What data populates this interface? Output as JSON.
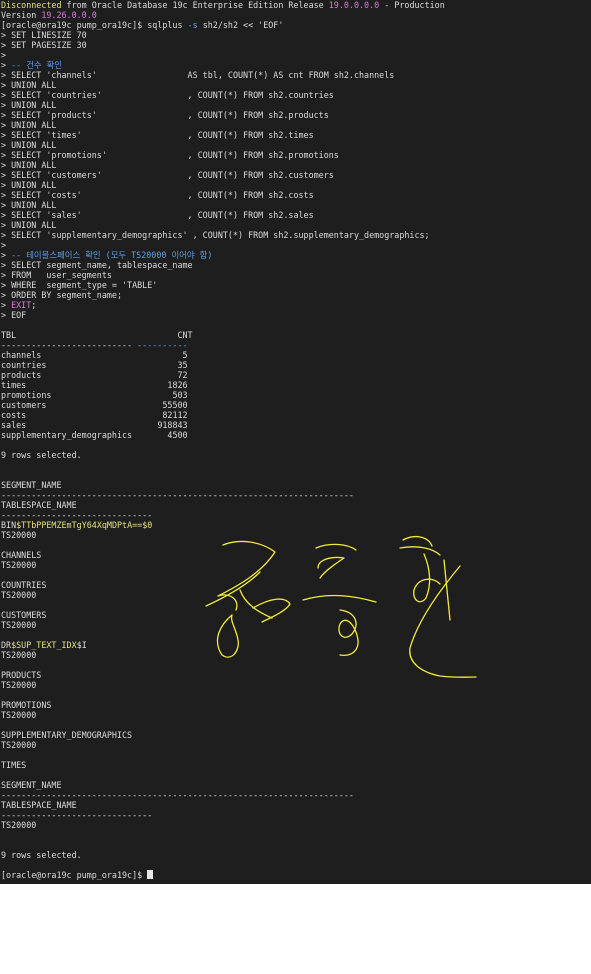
{
  "terminal": {
    "banner": [
      {
        "segs": [
          {
            "t": "Disconnected",
            "c": "c-yel"
          },
          {
            "t": " from Oracle Database 19c Enterprise Edition Release "
          },
          {
            "t": "19.0.0.0.0",
            "c": "c-mag"
          },
          {
            "t": " - Production"
          }
        ]
      },
      {
        "segs": [
          {
            "t": "Version "
          },
          {
            "t": "19.26.0.0.0",
            "c": "c-mag"
          }
        ]
      }
    ],
    "command": [
      {
        "segs": [
          {
            "t": "[oracle@ora19c pump_ora19c]$ sqlplus "
          },
          {
            "t": "-s",
            "c": "c-blue"
          },
          {
            "t": " sh2/sh2 << 'EOF'"
          }
        ]
      },
      {
        "segs": [
          {
            "t": "> SET LINESIZE 70"
          }
        ]
      },
      {
        "segs": [
          {
            "t": "> SET PAGESIZE 30"
          }
        ]
      },
      {
        "segs": [
          {
            "t": ">"
          }
        ]
      },
      {
        "segs": [
          {
            "t": "> "
          },
          {
            "t": "-- 건수 확인",
            "c": "c-blue"
          }
        ]
      },
      {
        "segs": [
          {
            "t": "> SELECT 'channels'                  AS tbl, COUNT(*) AS cnt FROM sh2.channels"
          }
        ]
      },
      {
        "segs": [
          {
            "t": "> UNION ALL"
          }
        ]
      },
      {
        "segs": [
          {
            "t": "> SELECT 'countries'                 , COUNT(*) FROM sh2.countries"
          }
        ]
      },
      {
        "segs": [
          {
            "t": "> UNION ALL"
          }
        ]
      },
      {
        "segs": [
          {
            "t": "> SELECT 'products'                  , COUNT(*) FROM sh2.products"
          }
        ]
      },
      {
        "segs": [
          {
            "t": "> UNION ALL"
          }
        ]
      },
      {
        "segs": [
          {
            "t": "> SELECT 'times'                     , COUNT(*) FROM sh2.times"
          }
        ]
      },
      {
        "segs": [
          {
            "t": "> UNION ALL"
          }
        ]
      },
      {
        "segs": [
          {
            "t": "> SELECT 'promotions'                , COUNT(*) FROM sh2.promotions"
          }
        ]
      },
      {
        "segs": [
          {
            "t": "> UNION ALL"
          }
        ]
      },
      {
        "segs": [
          {
            "t": "> SELECT 'customers'                 , COUNT(*) FROM sh2.customers"
          }
        ]
      },
      {
        "segs": [
          {
            "t": "> UNION ALL"
          }
        ]
      },
      {
        "segs": [
          {
            "t": "> SELECT 'costs'                     , COUNT(*) FROM sh2.costs"
          }
        ]
      },
      {
        "segs": [
          {
            "t": "> UNION ALL"
          }
        ]
      },
      {
        "segs": [
          {
            "t": "> SELECT 'sales'                     , COUNT(*) FROM sh2.sales"
          }
        ]
      },
      {
        "segs": [
          {
            "t": "> UNION ALL"
          }
        ]
      },
      {
        "segs": [
          {
            "t": "> SELECT 'supplementary_demographics' , COUNT(*) FROM sh2.supplementary_demographics;"
          }
        ]
      },
      {
        "segs": [
          {
            "t": ">"
          }
        ]
      },
      {
        "segs": [
          {
            "t": "> "
          },
          {
            "t": "-- 테이블스페이스 확인 (모두 TS20000 이어야 함)",
            "c": "c-blue"
          }
        ]
      },
      {
        "segs": [
          {
            "t": "> SELECT segment_name, tablespace_name"
          }
        ]
      },
      {
        "segs": [
          {
            "t": "> FROM   user_segments"
          }
        ]
      },
      {
        "segs": [
          {
            "t": "> WHERE  segment_type = 'TABLE'"
          }
        ]
      },
      {
        "segs": [
          {
            "t": "> ORDER BY segment_name;"
          }
        ]
      },
      {
        "segs": [
          {
            "t": "> "
          },
          {
            "t": "EXIT",
            "c": "c-mag"
          },
          {
            "t": ";"
          }
        ]
      },
      {
        "segs": [
          {
            "t": "> EOF"
          }
        ]
      },
      {
        "segs": [
          {
            "t": ""
          }
        ]
      }
    ],
    "count_table": {
      "header": "TBL                                CNT",
      "rule": "-------------------------- ----------",
      "rows": [
        {
          "tbl": "channels",
          "cnt": "5"
        },
        {
          "tbl": "countries",
          "cnt": "35"
        },
        {
          "tbl": "products",
          "cnt": "72"
        },
        {
          "tbl": "times",
          "cnt": "1826"
        },
        {
          "tbl": "promotions",
          "cnt": "503"
        },
        {
          "tbl": "customers",
          "cnt": "55500"
        },
        {
          "tbl": "costs",
          "cnt": "82112"
        },
        {
          "tbl": "sales",
          "cnt": "918843"
        },
        {
          "tbl": "supplementary_demographics",
          "cnt": "4500"
        }
      ],
      "rows_selected": "9 rows selected."
    },
    "segment_output": [
      {
        "segs": [
          {
            "t": ""
          }
        ]
      },
      {
        "segs": [
          {
            "t": ""
          }
        ]
      },
      {
        "segs": [
          {
            "t": "SEGMENT_NAME"
          }
        ]
      },
      {
        "segs": [
          {
            "t": "----------------------------------------------------------------------"
          }
        ]
      },
      {
        "segs": [
          {
            "t": "TABLESPACE_NAME"
          }
        ]
      },
      {
        "segs": [
          {
            "t": "------------------------------"
          }
        ]
      },
      {
        "segs": [
          {
            "t": "BIN"
          },
          {
            "t": "$TTbPPEMZEmTgY64XqMDPtA==$0",
            "c": "c-yel"
          }
        ]
      },
      {
        "segs": [
          {
            "t": "TS20000"
          }
        ]
      },
      {
        "segs": [
          {
            "t": ""
          }
        ]
      },
      {
        "segs": [
          {
            "t": "CHANNELS"
          }
        ]
      },
      {
        "segs": [
          {
            "t": "TS20000"
          }
        ]
      },
      {
        "segs": [
          {
            "t": ""
          }
        ]
      },
      {
        "segs": [
          {
            "t": "COUNTRIES"
          }
        ]
      },
      {
        "segs": [
          {
            "t": "TS20000"
          }
        ]
      },
      {
        "segs": [
          {
            "t": ""
          }
        ]
      },
      {
        "segs": [
          {
            "t": "CUSTOMERS"
          }
        ]
      },
      {
        "segs": [
          {
            "t": "TS20000"
          }
        ]
      },
      {
        "segs": [
          {
            "t": ""
          }
        ]
      },
      {
        "segs": [
          {
            "t": "DR"
          },
          {
            "t": "$SUP_TEXT_IDX",
            "c": "c-yel"
          },
          {
            "t": "$I"
          }
        ]
      },
      {
        "segs": [
          {
            "t": "TS20000"
          }
        ]
      },
      {
        "segs": [
          {
            "t": ""
          }
        ]
      },
      {
        "segs": [
          {
            "t": "PRODUCTS"
          }
        ]
      },
      {
        "segs": [
          {
            "t": "TS20000"
          }
        ]
      },
      {
        "segs": [
          {
            "t": ""
          }
        ]
      },
      {
        "segs": [
          {
            "t": "PROMOTIONS"
          }
        ]
      },
      {
        "segs": [
          {
            "t": "TS20000"
          }
        ]
      },
      {
        "segs": [
          {
            "t": ""
          }
        ]
      },
      {
        "segs": [
          {
            "t": "SUPPLEMENTARY_DEMOGRAPHICS"
          }
        ]
      },
      {
        "segs": [
          {
            "t": "TS20000"
          }
        ]
      },
      {
        "segs": [
          {
            "t": ""
          }
        ]
      },
      {
        "segs": [
          {
            "t": "TIMES"
          }
        ]
      },
      {
        "segs": [
          {
            "t": ""
          }
        ]
      },
      {
        "segs": [
          {
            "t": "SEGMENT_NAME"
          }
        ]
      },
      {
        "segs": [
          {
            "t": "----------------------------------------------------------------------"
          }
        ]
      },
      {
        "segs": [
          {
            "t": "TABLESPACE_NAME"
          }
        ]
      },
      {
        "segs": [
          {
            "t": "------------------------------"
          }
        ]
      },
      {
        "segs": [
          {
            "t": "TS20000"
          }
        ]
      },
      {
        "segs": [
          {
            "t": ""
          }
        ]
      },
      {
        "segs": [
          {
            "t": ""
          }
        ]
      },
      {
        "segs": [
          {
            "t": "9 rows selected."
          }
        ]
      },
      {
        "segs": [
          {
            "t": ""
          }
        ]
      }
    ],
    "final_prompt": "[oracle@ora19c pump_ora19c]$ ",
    "colors": {
      "background": "#1e1e1e",
      "text": "#dcdcdc",
      "yellow": "#e5e07a",
      "magenta": "#d97bd9",
      "blue": "#5f9fe8",
      "signature_ink": "#f2ea3a"
    },
    "icons": {
      "cursor": "block-cursor-icon"
    }
  }
}
